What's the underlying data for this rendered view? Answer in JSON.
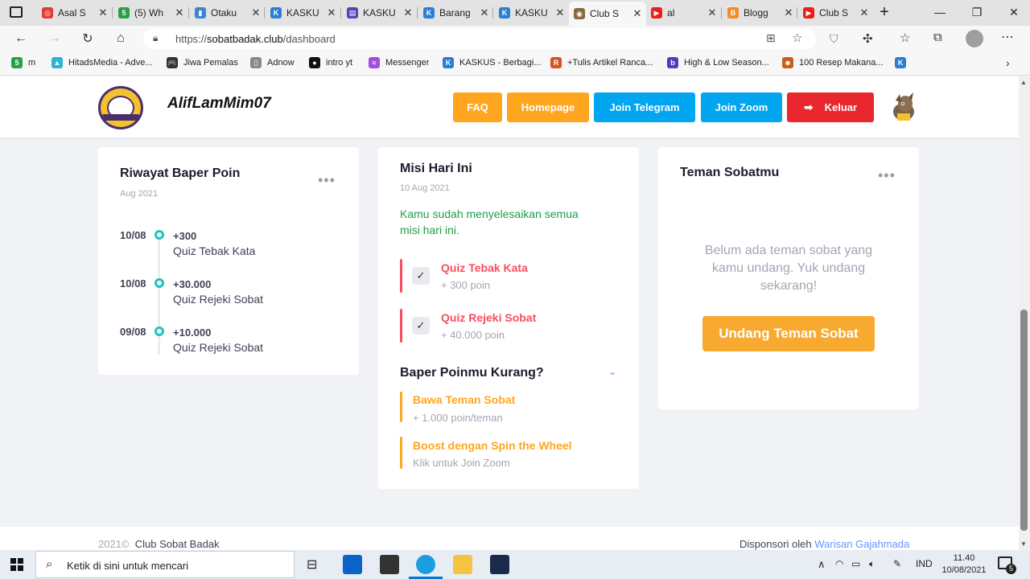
{
  "browser": {
    "tabs": [
      {
        "title": "Asal S",
        "color": "#e53935",
        "glyph": "◎"
      },
      {
        "title": "(5) Wh",
        "color": "#25a244",
        "glyph": "5"
      },
      {
        "title": "Otaku",
        "color": "#3a86d4",
        "glyph": "▮"
      },
      {
        "title": "KASKU",
        "color": "#2a7fd4",
        "glyph": "K"
      },
      {
        "title": "KASKU",
        "color": "#5b3fb8",
        "glyph": "▤"
      },
      {
        "title": "Barang",
        "color": "#2a7fd4",
        "glyph": "K"
      },
      {
        "title": "KASKU",
        "color": "#2a7fd4",
        "glyph": "K"
      },
      {
        "title": "Club S",
        "color": "#8a6a3a",
        "glyph": "◉"
      },
      {
        "title": "al",
        "color": "#e62117",
        "glyph": "▶"
      },
      {
        "title": "Blogg",
        "color": "#f58a1f",
        "glyph": "B"
      },
      {
        "title": "Club S",
        "color": "#e62117",
        "glyph": "▶"
      }
    ],
    "url_prefix": "https://",
    "url_domain": "sobatbadak.club",
    "url_path": "/dashboard",
    "bookmarks": [
      {
        "label": "m",
        "color": "#25a244",
        "glyph": "5"
      },
      {
        "label": "HitadsMedia - Adve...",
        "color": "#2bb5d0",
        "glyph": "▲"
      },
      {
        "label": "Jiwa Pemalas",
        "color": "#333333",
        "glyph": "🎮"
      },
      {
        "label": "Adnow",
        "color": "#888888",
        "glyph": "▯"
      },
      {
        "label": "intro yt",
        "color": "#111111",
        "glyph": "●"
      },
      {
        "label": "Messenger",
        "color": "#a24ee0",
        "glyph": "≈"
      },
      {
        "label": "KASKUS - Berbagi...",
        "color": "#2a7fd4",
        "glyph": "K"
      },
      {
        "label": "+Tulis Artikel Ranca...",
        "color": "#d4541f",
        "glyph": "R"
      },
      {
        "label": "High & Low Season...",
        "color": "#4b3fc0",
        "glyph": "b"
      },
      {
        "label": "100 Resep Makana...",
        "color": "#c95f1a",
        "glyph": "☻"
      },
      {
        "label": "",
        "color": "#2a7fd4",
        "glyph": "K"
      }
    ]
  },
  "header": {
    "username": "AlifLamMim07",
    "buttons": {
      "faq": "FAQ",
      "homepage": "Homepage",
      "telegram": "Join Telegram",
      "zoom": "Join Zoom",
      "logout": "Keluar"
    },
    "colors": {
      "orange": "#ffa61e",
      "blue": "#00a6f0",
      "red": "#e8282d"
    }
  },
  "riwayat": {
    "title": "Riwayat Baper Poin",
    "subtitle": "Aug 2021",
    "menu": "•••",
    "items": [
      {
        "date": "10/08",
        "amount": "+300",
        "desc": "Quiz Tebak Kata"
      },
      {
        "date": "10/08",
        "amount": "+30.000",
        "desc": "Quiz Rejeki Sobat"
      },
      {
        "date": "09/08",
        "amount": "+10.000",
        "desc": "Quiz Rejeki Sobat"
      }
    ]
  },
  "misi": {
    "title": "Misi Hari Ini",
    "subtitle": "10 Aug 2021",
    "message_line1": "Kamu sudah menyelesaikan semua",
    "message_line2": "misi hari ini.",
    "missions": [
      {
        "title": "Quiz Tebak Kata",
        "reward": "+ 300 poin"
      },
      {
        "title": "Quiz Rejeki Sobat",
        "reward": "+ 40.000 poin"
      }
    ],
    "kurang_title": "Baper Poinmu Kurang?",
    "tips": [
      {
        "title": "Bawa Teman Sobat",
        "sub": "+ 1.000 poin/teman"
      },
      {
        "title": "Boost dengan Spin the Wheel",
        "sub": "Klik untuk Join Zoom"
      }
    ],
    "colors": {
      "mission": "#f64e60",
      "tip": "#ffa61e"
    }
  },
  "teman": {
    "title": "Teman Sobatmu",
    "menu": "•••",
    "empty_line1": "Belum ada teman sobat yang",
    "empty_line2": "kamu undang. Yuk undang",
    "empty_line3": "sekarang!",
    "invite_button": "Undang Teman Sobat"
  },
  "footer": {
    "year": "2021©",
    "brand": "Club Sobat Badak",
    "sponsor_prefix": "Disponsori oleh",
    "sponsor_link": "Warisan Gajahmada"
  },
  "taskbar": {
    "search_placeholder": "Ketik di sini untuk mencari",
    "lang": "IND",
    "time": "11.40",
    "date": "10/08/2021",
    "notif_count": "5"
  }
}
